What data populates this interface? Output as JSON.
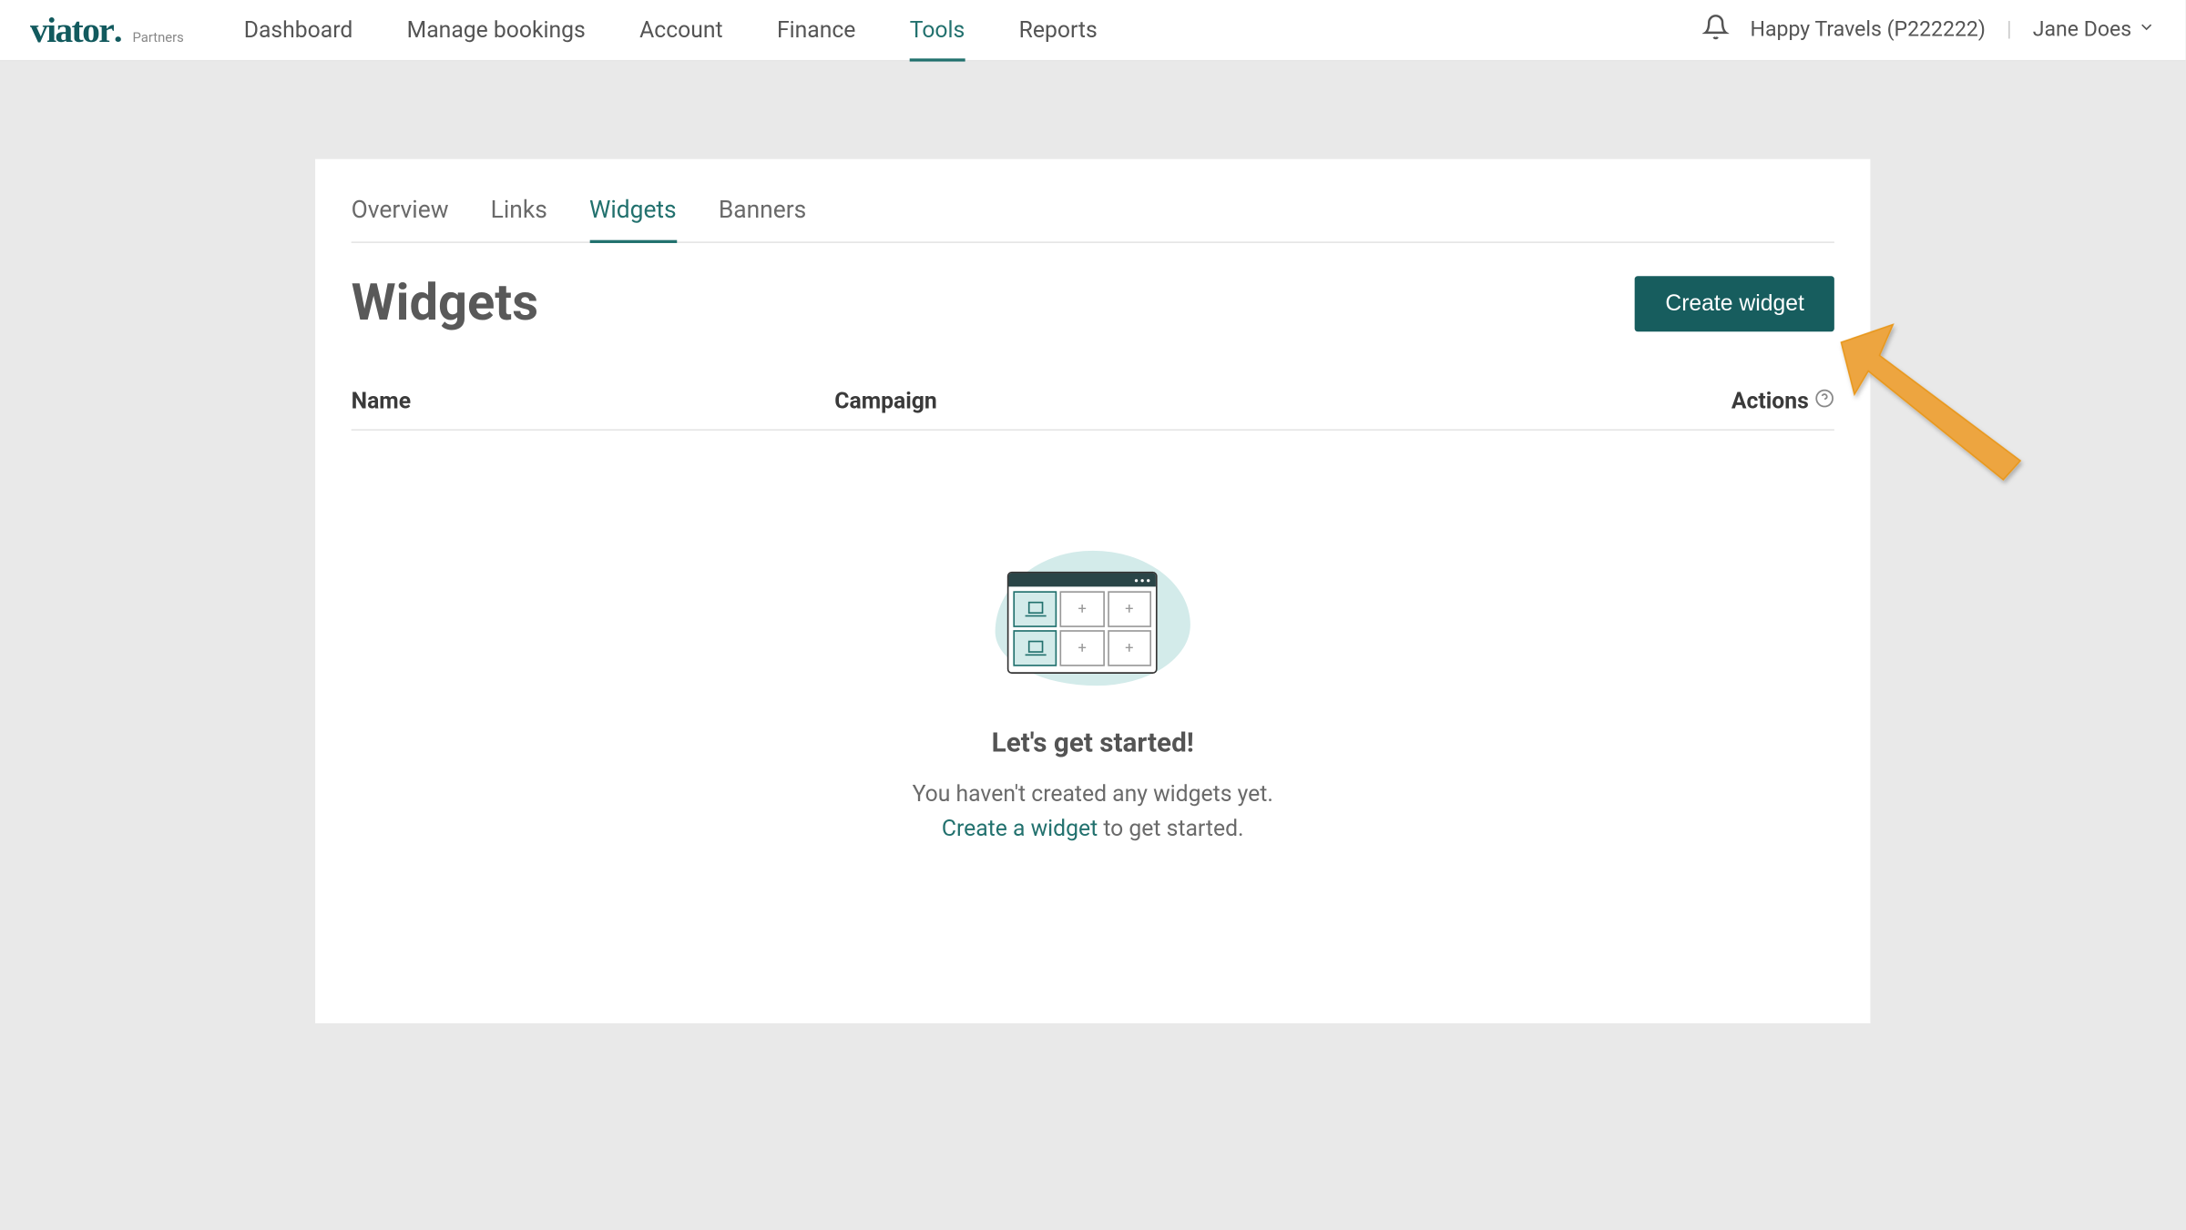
{
  "logo": {
    "main": "viator",
    "dot": ".",
    "sub": "Partners"
  },
  "mainNav": {
    "items": [
      {
        "label": "Dashboard",
        "active": false
      },
      {
        "label": "Manage bookings",
        "active": false
      },
      {
        "label": "Account",
        "active": false
      },
      {
        "label": "Finance",
        "active": false
      },
      {
        "label": "Tools",
        "active": true
      },
      {
        "label": "Reports",
        "active": false
      }
    ]
  },
  "account": {
    "company": "Happy Travels (P222222)",
    "user": "Jane Does"
  },
  "subNav": {
    "items": [
      {
        "label": "Overview",
        "active": false
      },
      {
        "label": "Links",
        "active": false
      },
      {
        "label": "Widgets",
        "active": true
      },
      {
        "label": "Banners",
        "active": false
      }
    ]
  },
  "page": {
    "title": "Widgets",
    "createButton": "Create widget"
  },
  "table": {
    "columns": {
      "name": "Name",
      "campaign": "Campaign",
      "actions": "Actions"
    }
  },
  "emptyState": {
    "title": "Let's get started!",
    "text1": "You haven't created any widgets yet.",
    "linkText": "Create a widget",
    "text2": " to get started."
  }
}
